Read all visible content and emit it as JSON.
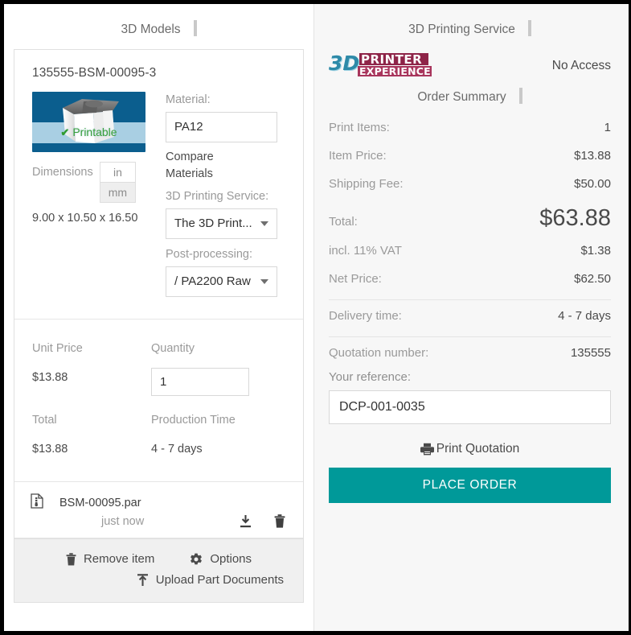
{
  "left_pane": {
    "header": "3D Models",
    "part": {
      "id": "135555-BSM-00095-3",
      "thumbnail_badge": "Printable",
      "thumbnail_badge_icon": "check-icon",
      "dimensions_label": "Dimensions",
      "unit_in": "in",
      "unit_mm": "mm",
      "unit_selected": "mm",
      "dimensions_value": "9.00 x 10.50 x 16.50",
      "material_label": "Material:",
      "material_value": "PA12",
      "compare_materials_link": "Compare Materials",
      "service_label": "3D Printing Service:",
      "service_value": "The 3D Print...",
      "postprocessing_label": "Post-processing:",
      "postprocessing_value": "/ PA2200 Raw"
    },
    "pricing": {
      "unit_price_label": "Unit Price",
      "unit_price_value": "$13.88",
      "quantity_label": "Quantity",
      "quantity_value": "1",
      "total_label": "Total",
      "total_value": "$13.88",
      "production_time_label": "Production Time",
      "production_time_value": "4 - 7 days"
    },
    "file": {
      "icon": "file-document-icon",
      "name": "BSM-00095.par",
      "time": "just now",
      "download_icon": "download-icon",
      "delete_icon": "trash-icon"
    },
    "actions": {
      "remove_item": "Remove item",
      "remove_item_icon": "trash-icon",
      "options": "Options",
      "options_icon": "gear-icon",
      "upload_part_documents": "Upload Part Documents",
      "upload_icon": "upload-icon"
    }
  },
  "right_pane": {
    "header": "3D Printing Service",
    "logo_alt": "3D Printer Experience",
    "logo_text_primary": "3D",
    "logo_text_secondary": "PRINTER",
    "logo_text_tertiary": "EXPERIENCE",
    "access_status": "No Access",
    "order_summary_header": "Order Summary",
    "summary_rows": [
      {
        "label": "Print Items:",
        "value": "1"
      },
      {
        "label": "Item Price:",
        "value": "$13.88"
      },
      {
        "label": "Shipping Fee:",
        "value": "$50.00"
      }
    ],
    "total_label": "Total:",
    "total_value": "$63.88",
    "tax_rows": [
      {
        "label": "incl. 11% VAT",
        "value": "$1.38"
      },
      {
        "label": "Net Price:",
        "value": "$62.50"
      }
    ],
    "delivery_label": "Delivery time:",
    "delivery_value": "4 - 7 days",
    "quotation_label": "Quotation number:",
    "quotation_value": "135555",
    "reference_label": "Your reference:",
    "reference_value": "DCP-001-0035",
    "print_quotation": "Print Quotation",
    "print_icon": "printer-icon",
    "place_order": "PLACE ORDER"
  },
  "colors": {
    "accent_teal": "#009999",
    "thumb_blue": "#0b5e8e",
    "thumb_band": "#a9cfe3",
    "printable_green": "#3aa03a",
    "logo_teal": "#2e8aa8",
    "logo_maroon": "#a8355c",
    "right_bg": "#f7f7f7",
    "muted_text": "#9a9a9a",
    "body_text": "#4a4a4a"
  }
}
